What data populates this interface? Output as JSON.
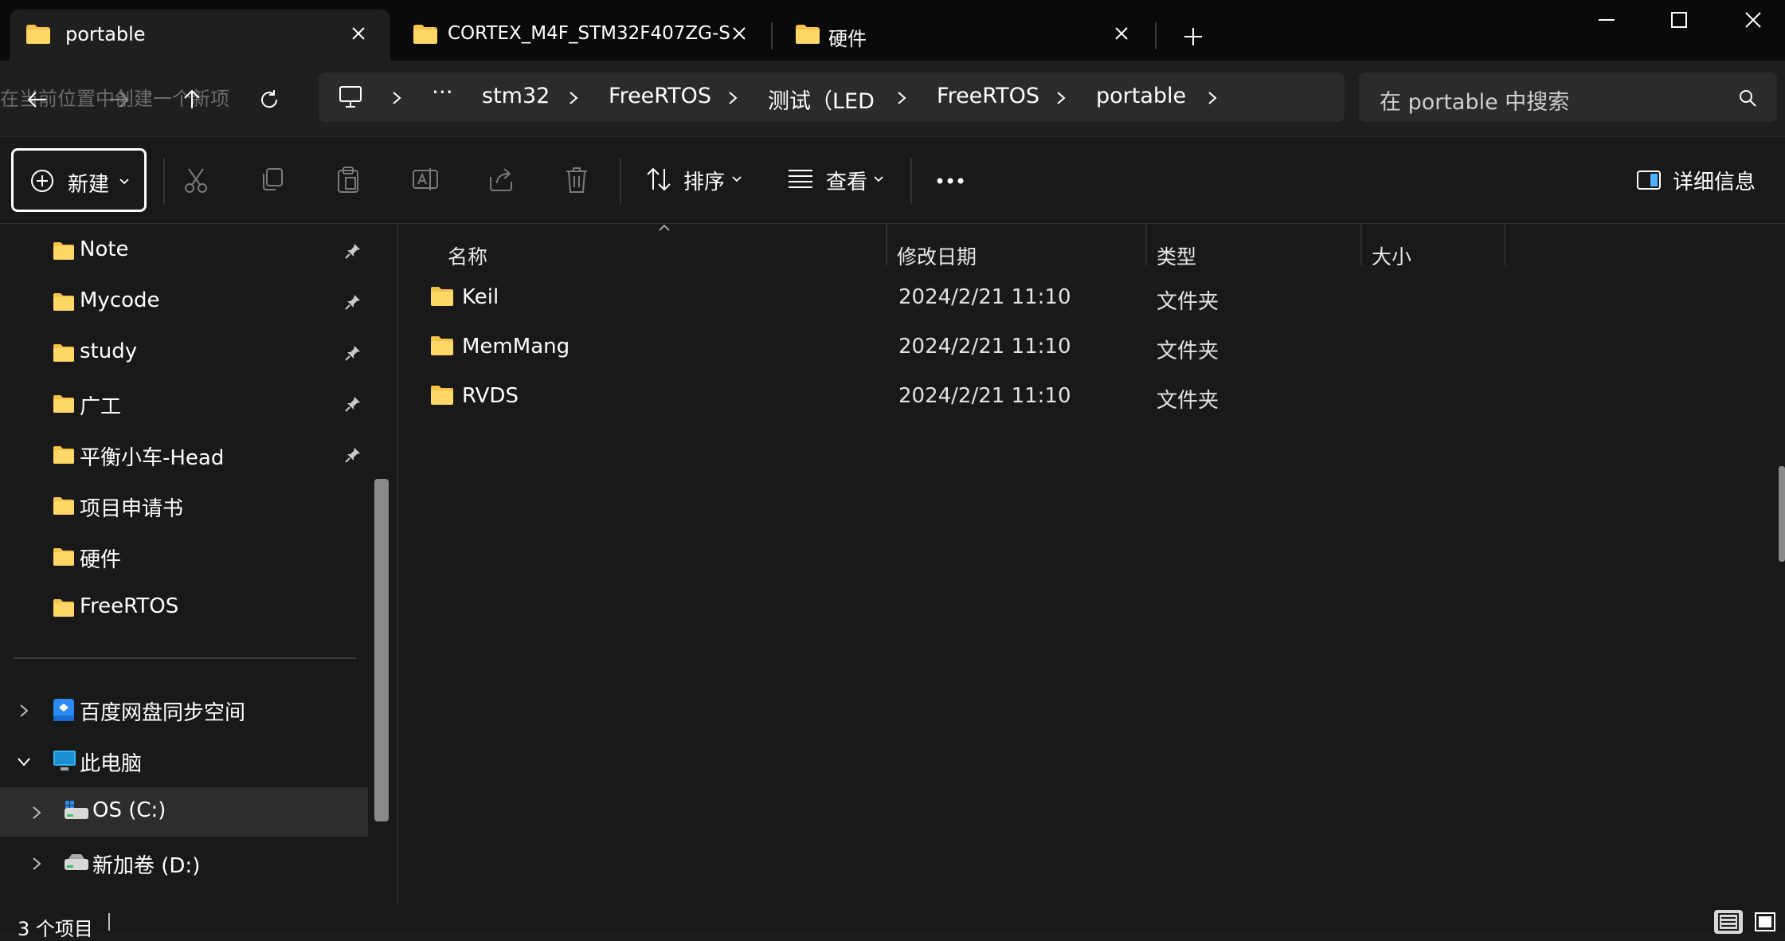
{
  "tabs": [
    {
      "label": "portable",
      "active": true
    },
    {
      "label": "CORTEX_M4F_STM32F407ZG-S",
      "active": false
    },
    {
      "label": "硬件",
      "active": false
    }
  ],
  "address": {
    "ghost_text": "在当前位置中创建一个新项目。",
    "crumbs": [
      "stm32",
      "FreeRTOS",
      "测试（LED",
      "FreeRTOS",
      "portable"
    ]
  },
  "search": {
    "placeholder": "在 portable 中搜索"
  },
  "toolbar": {
    "new_label": "新建",
    "sort_label": "排序",
    "view_label": "查看",
    "details_label": "详细信息"
  },
  "sidebar": {
    "quick_access": [
      {
        "label": "Note",
        "pinned": true
      },
      {
        "label": "Mycode",
        "pinned": true
      },
      {
        "label": "study",
        "pinned": true
      },
      {
        "label": "广工",
        "pinned": true
      },
      {
        "label": "平衡小车-Head",
        "pinned": true
      },
      {
        "label": "项目申请书",
        "pinned": false
      },
      {
        "label": "硬件",
        "pinned": false
      },
      {
        "label": "FreeRTOS",
        "pinned": false
      }
    ],
    "tree": [
      {
        "label": "百度网盘同步空间",
        "expanded": false
      },
      {
        "label": "此电脑",
        "expanded": true
      },
      {
        "label": "OS (C:)",
        "expanded": false,
        "selected": true
      },
      {
        "label": "新加卷 (D:)",
        "expanded": false
      }
    ]
  },
  "columns": {
    "name": "名称",
    "date": "修改日期",
    "type": "类型",
    "size": "大小"
  },
  "files": [
    {
      "name": "Keil",
      "date": "2024/2/21 11:10",
      "type": "文件夹",
      "size": ""
    },
    {
      "name": "MemMang",
      "date": "2024/2/21 11:10",
      "type": "文件夹",
      "size": ""
    },
    {
      "name": "RVDS",
      "date": "2024/2/21 11:10",
      "type": "文件夹",
      "size": ""
    }
  ],
  "status": {
    "count_text": "3 个项目"
  },
  "colors": {
    "folder": "#f5c24a",
    "background": "#191919",
    "titlebar": "#0a0a0a",
    "selected": "#2d2d2d"
  }
}
